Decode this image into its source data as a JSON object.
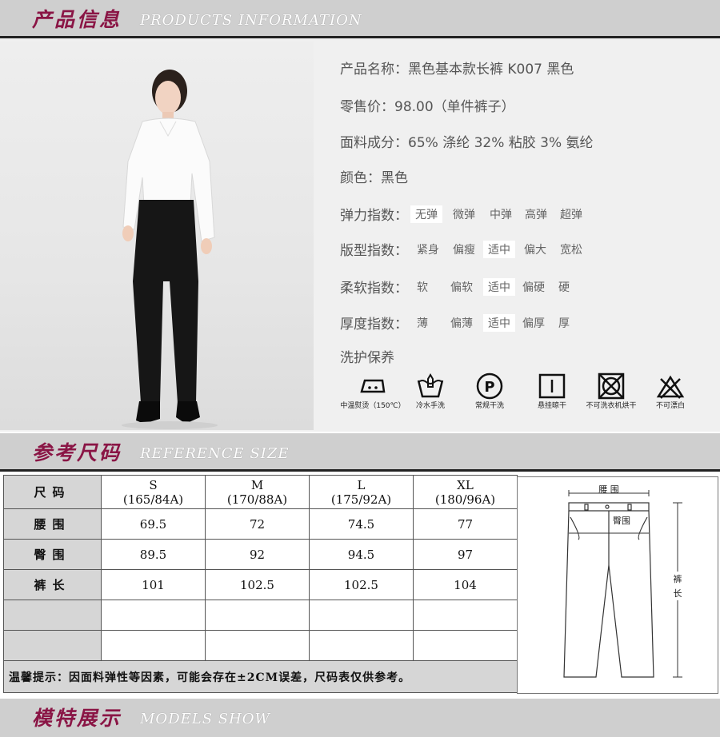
{
  "products_header": {
    "cn": "产品信息",
    "en": "PRODUCTS INFORMATION"
  },
  "product": {
    "name": "产品名称：黑色基本款长裤 K007 黑色",
    "price": "零售价：98.00（单件裤子）",
    "fabric": "面料成分：65% 涤纶 32% 粘胶 3% 氨纶",
    "color": "颜色：黑色"
  },
  "indices": [
    {
      "label": "弹力指数：",
      "options": [
        "无弹",
        "微弹",
        "中弹",
        "高弹",
        "超弹"
      ],
      "selected": "无弹"
    },
    {
      "label": "版型指数：",
      "options": [
        "紧身",
        "偏瘦",
        "适中",
        "偏大",
        "宽松"
      ],
      "selected": "适中"
    },
    {
      "label": "柔软指数：",
      "options": [
        "软",
        "偏软",
        "适中",
        "偏硬",
        "硬"
      ],
      "selected": "适中"
    },
    {
      "label": "厚度指数：",
      "options": [
        "薄",
        "偏薄",
        "适中",
        "偏厚",
        "厚"
      ],
      "selected": "适中"
    }
  ],
  "care_title": "洗护保养",
  "care": [
    {
      "icon": "iron-icon",
      "label": "中温熨烫（150℃）"
    },
    {
      "icon": "hand-wash-icon",
      "label": "冷水手洗"
    },
    {
      "icon": "dry-clean-icon",
      "label": "常规干洗"
    },
    {
      "icon": "hang-dry-icon",
      "label": "悬挂晾干"
    },
    {
      "icon": "no-tumble-dry-icon",
      "label": "不可洗衣机烘干"
    },
    {
      "icon": "no-bleach-icon",
      "label": "不可漂白"
    }
  ],
  "reference_header": {
    "cn": "参考尺码",
    "en": "REFERENCE SIZE"
  },
  "size_table": {
    "corner": "尺码",
    "columns": [
      {
        "size": "S",
        "spec": "(165/84A)"
      },
      {
        "size": "M",
        "spec": "(170/88A)"
      },
      {
        "size": "L",
        "spec": "(175/92A)"
      },
      {
        "size": "XL",
        "spec": "(180/96A)"
      }
    ],
    "rows": [
      {
        "label": "腰围",
        "values": [
          "69.5",
          "72",
          "74.5",
          "77"
        ]
      },
      {
        "label": "臀围",
        "values": [
          "89.5",
          "92",
          "94.5",
          "97"
        ]
      },
      {
        "label": "裤长",
        "values": [
          "101",
          "102.5",
          "102.5",
          "104"
        ]
      }
    ],
    "note": "温馨提示：因面料弹性等因素，可能会存在±2CM误差，尺码表仅供参考。"
  },
  "diagram": {
    "waist": "腰 围",
    "hip": "臀围",
    "length_top": "裤",
    "length_bottom": "长"
  },
  "models_header": {
    "cn": "模特展示",
    "en": "MODELS SHOW"
  }
}
